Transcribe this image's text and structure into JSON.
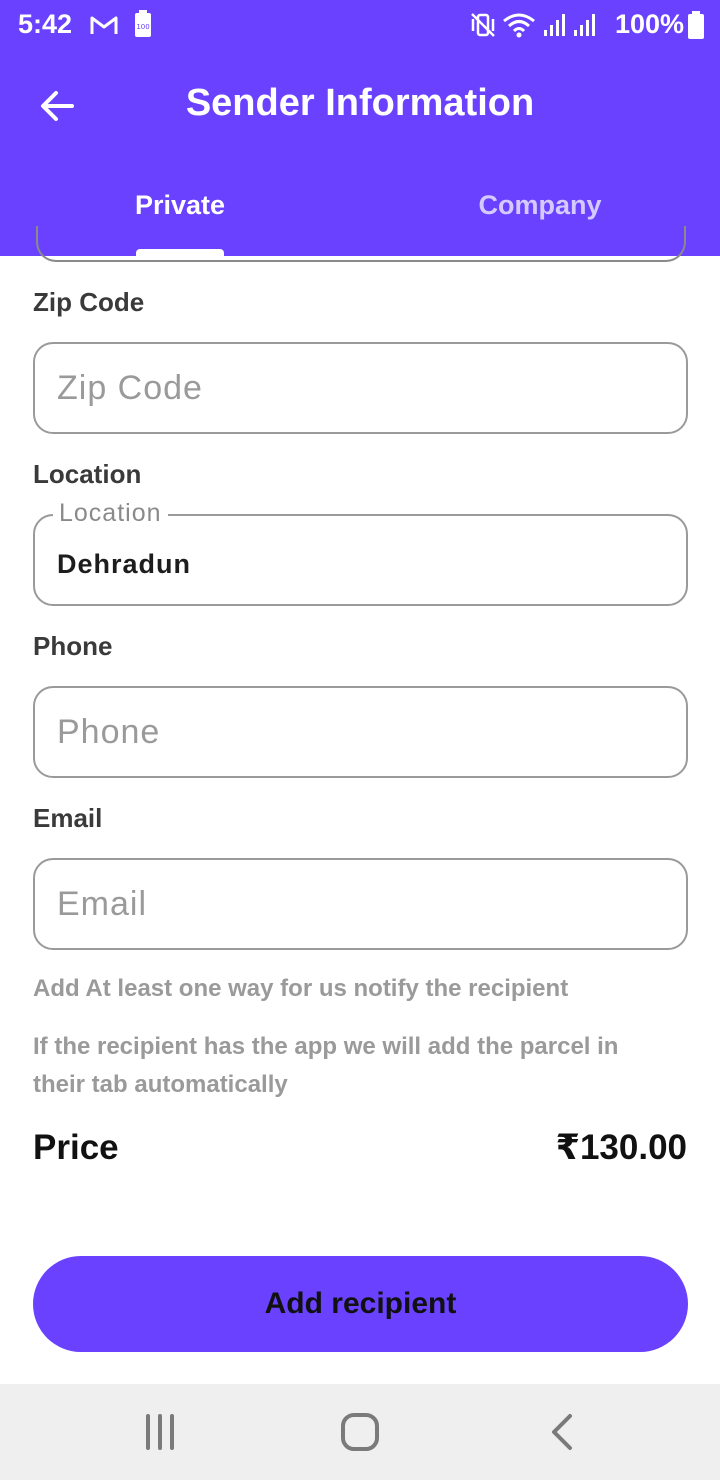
{
  "status_bar": {
    "time": "5:42",
    "battery": "100%",
    "icons": [
      "gmail-icon",
      "battery-saver-icon",
      "vibrate-icon",
      "wifi-icon",
      "signal-icon",
      "signal-icon",
      "battery-icon"
    ]
  },
  "app_bar": {
    "title": "Sender Information",
    "back_icon": "arrow-left-icon"
  },
  "tabs": [
    {
      "label": "Private",
      "selected": true
    },
    {
      "label": "Company",
      "selected": false
    }
  ],
  "form": {
    "zip": {
      "label": "Zip Code",
      "placeholder": "Zip Code",
      "value": ""
    },
    "location": {
      "label": "Location",
      "floating_label": "Location",
      "value": "Dehradun"
    },
    "phone": {
      "label": "Phone",
      "placeholder": "Phone",
      "value": ""
    },
    "email": {
      "label": "Email",
      "placeholder": "Email",
      "value": ""
    }
  },
  "help": {
    "line1": "Add At least one way for us notify the recipient",
    "line2": "If the recipient has the app we will add the parcel in their tab automatically"
  },
  "price": {
    "label": "Price",
    "value": "₹130.00"
  },
  "cta": {
    "label": "Add recipient"
  },
  "nav_bar": {
    "icons": [
      "recents-icon",
      "home-icon",
      "back-icon"
    ]
  },
  "colors": {
    "primary": "#6941FF",
    "nav_background": "#efefef",
    "label_text": "#3a3a3a",
    "hint_text": "#9a9a9a"
  }
}
